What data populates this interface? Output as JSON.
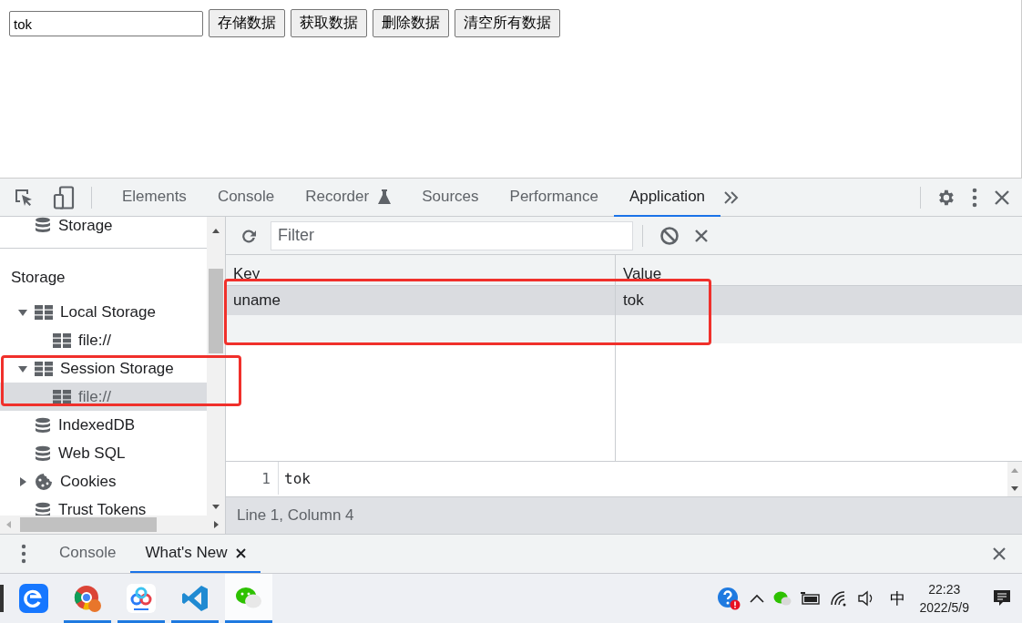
{
  "page": {
    "input": {
      "value": "tok"
    },
    "buttons": [
      "存储数据",
      "获取数据",
      "删除数据",
      "清空所有数据"
    ]
  },
  "devtools": {
    "tabs": [
      {
        "label": "Elements",
        "selected": false,
        "kind": "plain"
      },
      {
        "label": "Console",
        "selected": false,
        "kind": "plain"
      },
      {
        "label": "Recorder",
        "selected": false,
        "kind": "flask"
      },
      {
        "label": "Sources",
        "selected": false,
        "kind": "plain"
      },
      {
        "label": "Performance",
        "selected": false,
        "kind": "plain"
      },
      {
        "label": "Application",
        "selected": true,
        "kind": "plain"
      }
    ],
    "sidebar": {
      "top_item": {
        "label": "Storage",
        "kind": "database"
      },
      "section": "Storage",
      "tree": [
        {
          "label": "Local Storage",
          "kind": "grid",
          "expanded": true,
          "selected": false,
          "children": [
            {
              "label": "file://",
              "kind": "grid",
              "selected": false
            }
          ]
        },
        {
          "label": "Session Storage",
          "kind": "grid",
          "expanded": true,
          "selected": false,
          "children": [
            {
              "label": "file://",
              "kind": "grid",
              "selected": true
            }
          ]
        },
        {
          "label": "IndexedDB",
          "kind": "database",
          "selected": false
        },
        {
          "label": "Web SQL",
          "kind": "database",
          "selected": false
        },
        {
          "label": "Cookies",
          "kind": "cookie",
          "expanded": false,
          "selected": false
        },
        {
          "label": "Trust Tokens",
          "kind": "database",
          "selected": false
        }
      ]
    },
    "filter": {
      "placeholder": "Filter"
    },
    "table": {
      "columns": [
        "Key",
        "Value"
      ],
      "rows": [
        {
          "key": "uname",
          "value": "tok",
          "selected": true
        }
      ]
    },
    "editor": {
      "lines": [
        {
          "number": "1",
          "text": "tok"
        }
      ]
    },
    "status": "Line 1, Column 4",
    "drawer_tabs": [
      {
        "label": "Console",
        "selected": false,
        "closable": false
      },
      {
        "label": "What's New",
        "selected": true,
        "closable": true
      }
    ]
  },
  "taskbar": {
    "apps": [
      {
        "kind": "edge",
        "running": false,
        "selected": false
      },
      {
        "kind": "chrome",
        "running": true,
        "selected": false
      },
      {
        "kind": "cloud",
        "running": true,
        "selected": false
      },
      {
        "kind": "vscode",
        "running": true,
        "selected": false
      },
      {
        "kind": "wechat",
        "running": true,
        "selected": true
      }
    ],
    "ime": "中",
    "time": "22:23",
    "date": "2022/5/9"
  }
}
